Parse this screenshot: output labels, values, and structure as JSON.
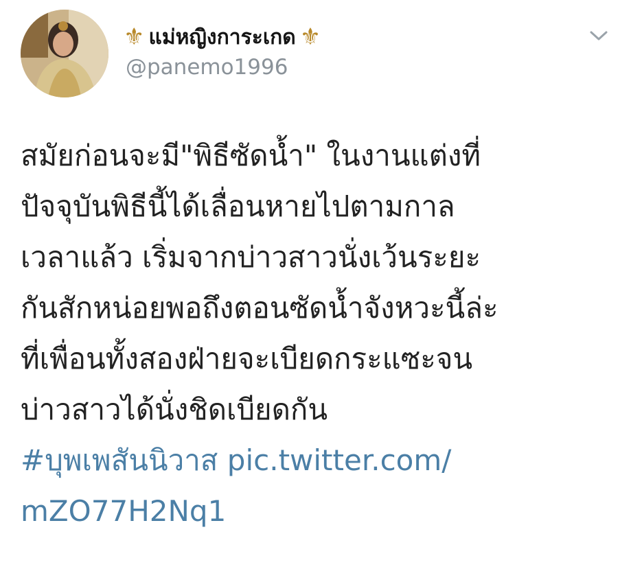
{
  "tweet": {
    "display_name": "แม่หญิงการะเกด",
    "decoration_left": "⚜",
    "decoration_right": "⚜",
    "handle": "@panemo1996",
    "text_lines": [
      "สมัยก่อนจะมี\"พิธีซัดน้ำ\" ในงานแต่งที่",
      "ปัจจุบันพิธีนี้ได้เลื่อนหายไปตามกาล",
      "เวลาแล้ว เริ่มจากบ่าวสาวนั่งเว้นระยะ",
      "กันสักหน่อยพอถึงตอนซัดน้ำจังหวะนี้ล่ะ",
      "ที่เพื่อนทั้งสองฝ่ายจะเบียดกระแซะจน",
      "บ่าวสาวได้นั่งชิดเบียดกัน"
    ],
    "hashtag": "#บุพเพสันนิวาส",
    "pic_link_part1": "pic.twitter.com/",
    "pic_link_part2": "mZO77H2Nq1",
    "link_color": "#4b7fa6",
    "menu_icon": "chevron-down-icon"
  }
}
